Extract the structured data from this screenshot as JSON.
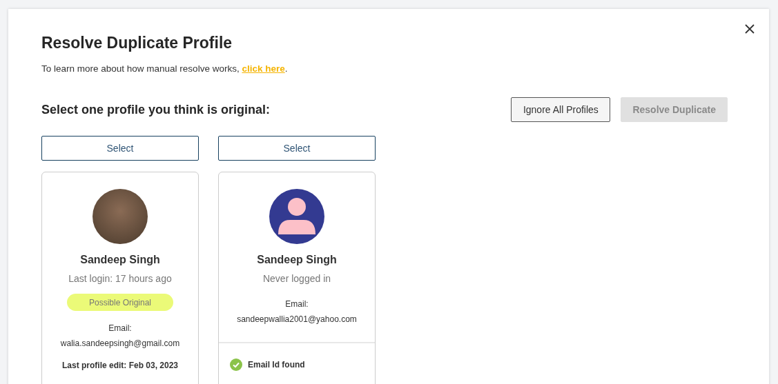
{
  "dialog": {
    "title": "Resolve Duplicate Profile",
    "intro": "To learn more about how manual resolve works,",
    "link": "click here",
    "intro_end": ".",
    "prompt": "Select one profile you think is original:",
    "buttons": [
      {
        "label": "Ignore All Profiles",
        "disabled": false
      },
      {
        "label": "Resolve Duplicate",
        "disabled": true
      }
    ]
  },
  "profiles": [
    {
      "select": "Select",
      "kind": "photo",
      "name": "Sandeep Singh",
      "login": "Last login: 17 hours ago",
      "badge": "Possible Original",
      "email_label": "Email:",
      "email": "walia.sandeepsingh@gmail.com",
      "last_edit": "Last profile edit: Feb 03, 2023"
    },
    {
      "select": "Select",
      "kind": "default",
      "name": "Sandeep Singh",
      "login": "Never logged in",
      "email_label": "Email:",
      "email": "sandeepwallia2001@yahoo.com",
      "checks": [
        {
          "label": "Email Id found",
          "found": true
        }
      ]
    }
  ]
}
